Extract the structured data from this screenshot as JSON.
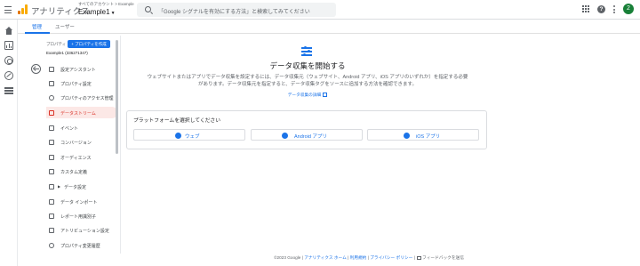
{
  "header": {
    "app_name": "アナリティクス",
    "account_breadcrumb": "すべてのアカウント > Example",
    "property_name": "Example1",
    "search_placeholder": "「Google シグナルを有効にする方法」と検索してみてください",
    "avatar_letter": "2"
  },
  "tabs": [
    {
      "label": "管理"
    },
    {
      "label": "ユーザー"
    }
  ],
  "admin_nav": {
    "property_label": "プロパティ",
    "create_property_label": "+ プロパティを作成",
    "property_selected": "Example1 (336271347)",
    "items": [
      {
        "label": "設定アシスタント",
        "icon": "checklist-icon"
      },
      {
        "label": "プロパティ設定",
        "icon": "property-settings-icon"
      },
      {
        "label": "プロパティのアクセス管理",
        "icon": "people-icon"
      },
      {
        "label": "データストリーム",
        "icon": "data-stream-icon"
      },
      {
        "label": "イベント",
        "icon": "event-icon"
      },
      {
        "label": "コンバージョン",
        "icon": "flag-icon"
      },
      {
        "label": "オーディエンス",
        "icon": "audience-icon"
      },
      {
        "label": "カスタム定義",
        "icon": "custom-definitions-icon"
      },
      {
        "label": "データ設定",
        "icon": "data-settings-icon"
      },
      {
        "label": "データ インポート",
        "icon": "upload-icon"
      },
      {
        "label": "レポート用識別子",
        "icon": "identity-icon"
      },
      {
        "label": "アトリビューション設定",
        "icon": "attribution-icon"
      },
      {
        "label": "プロパティ変更履歴",
        "icon": "history-icon"
      }
    ]
  },
  "main": {
    "title": "データ収集を開始する",
    "description_line1": "ウェブサイトまたはアプリでデータ収集を設定するには、データ収集元（ウェブサイト、Android アプリ、iOS アプリのいずれか）を指定する必要",
    "description_line2": "があります。データ収集元を指定すると、データ収集タグをソースに追加する方法を確認できます。",
    "learn_more": "データ収集の詳細",
    "platform_card_title": "プラットフォームを選択してください",
    "platform_buttons": [
      {
        "label": "ウェブ"
      },
      {
        "label": "Android アプリ"
      },
      {
        "label": "iOS アプリ"
      }
    ]
  },
  "footer": {
    "copyright": "©2023 Google |",
    "links": [
      "アナリティクス ホーム",
      "利用規約",
      "プライバシー ポリシー"
    ],
    "feedback": "フィードバックを送信"
  },
  "colors": {
    "accent": "#1a73e8",
    "active_nav_bg": "#fce8e6",
    "active_nav_text": "#d93025",
    "logo_orange": "#f9ab00",
    "logo_dark_orange": "#e37400"
  }
}
